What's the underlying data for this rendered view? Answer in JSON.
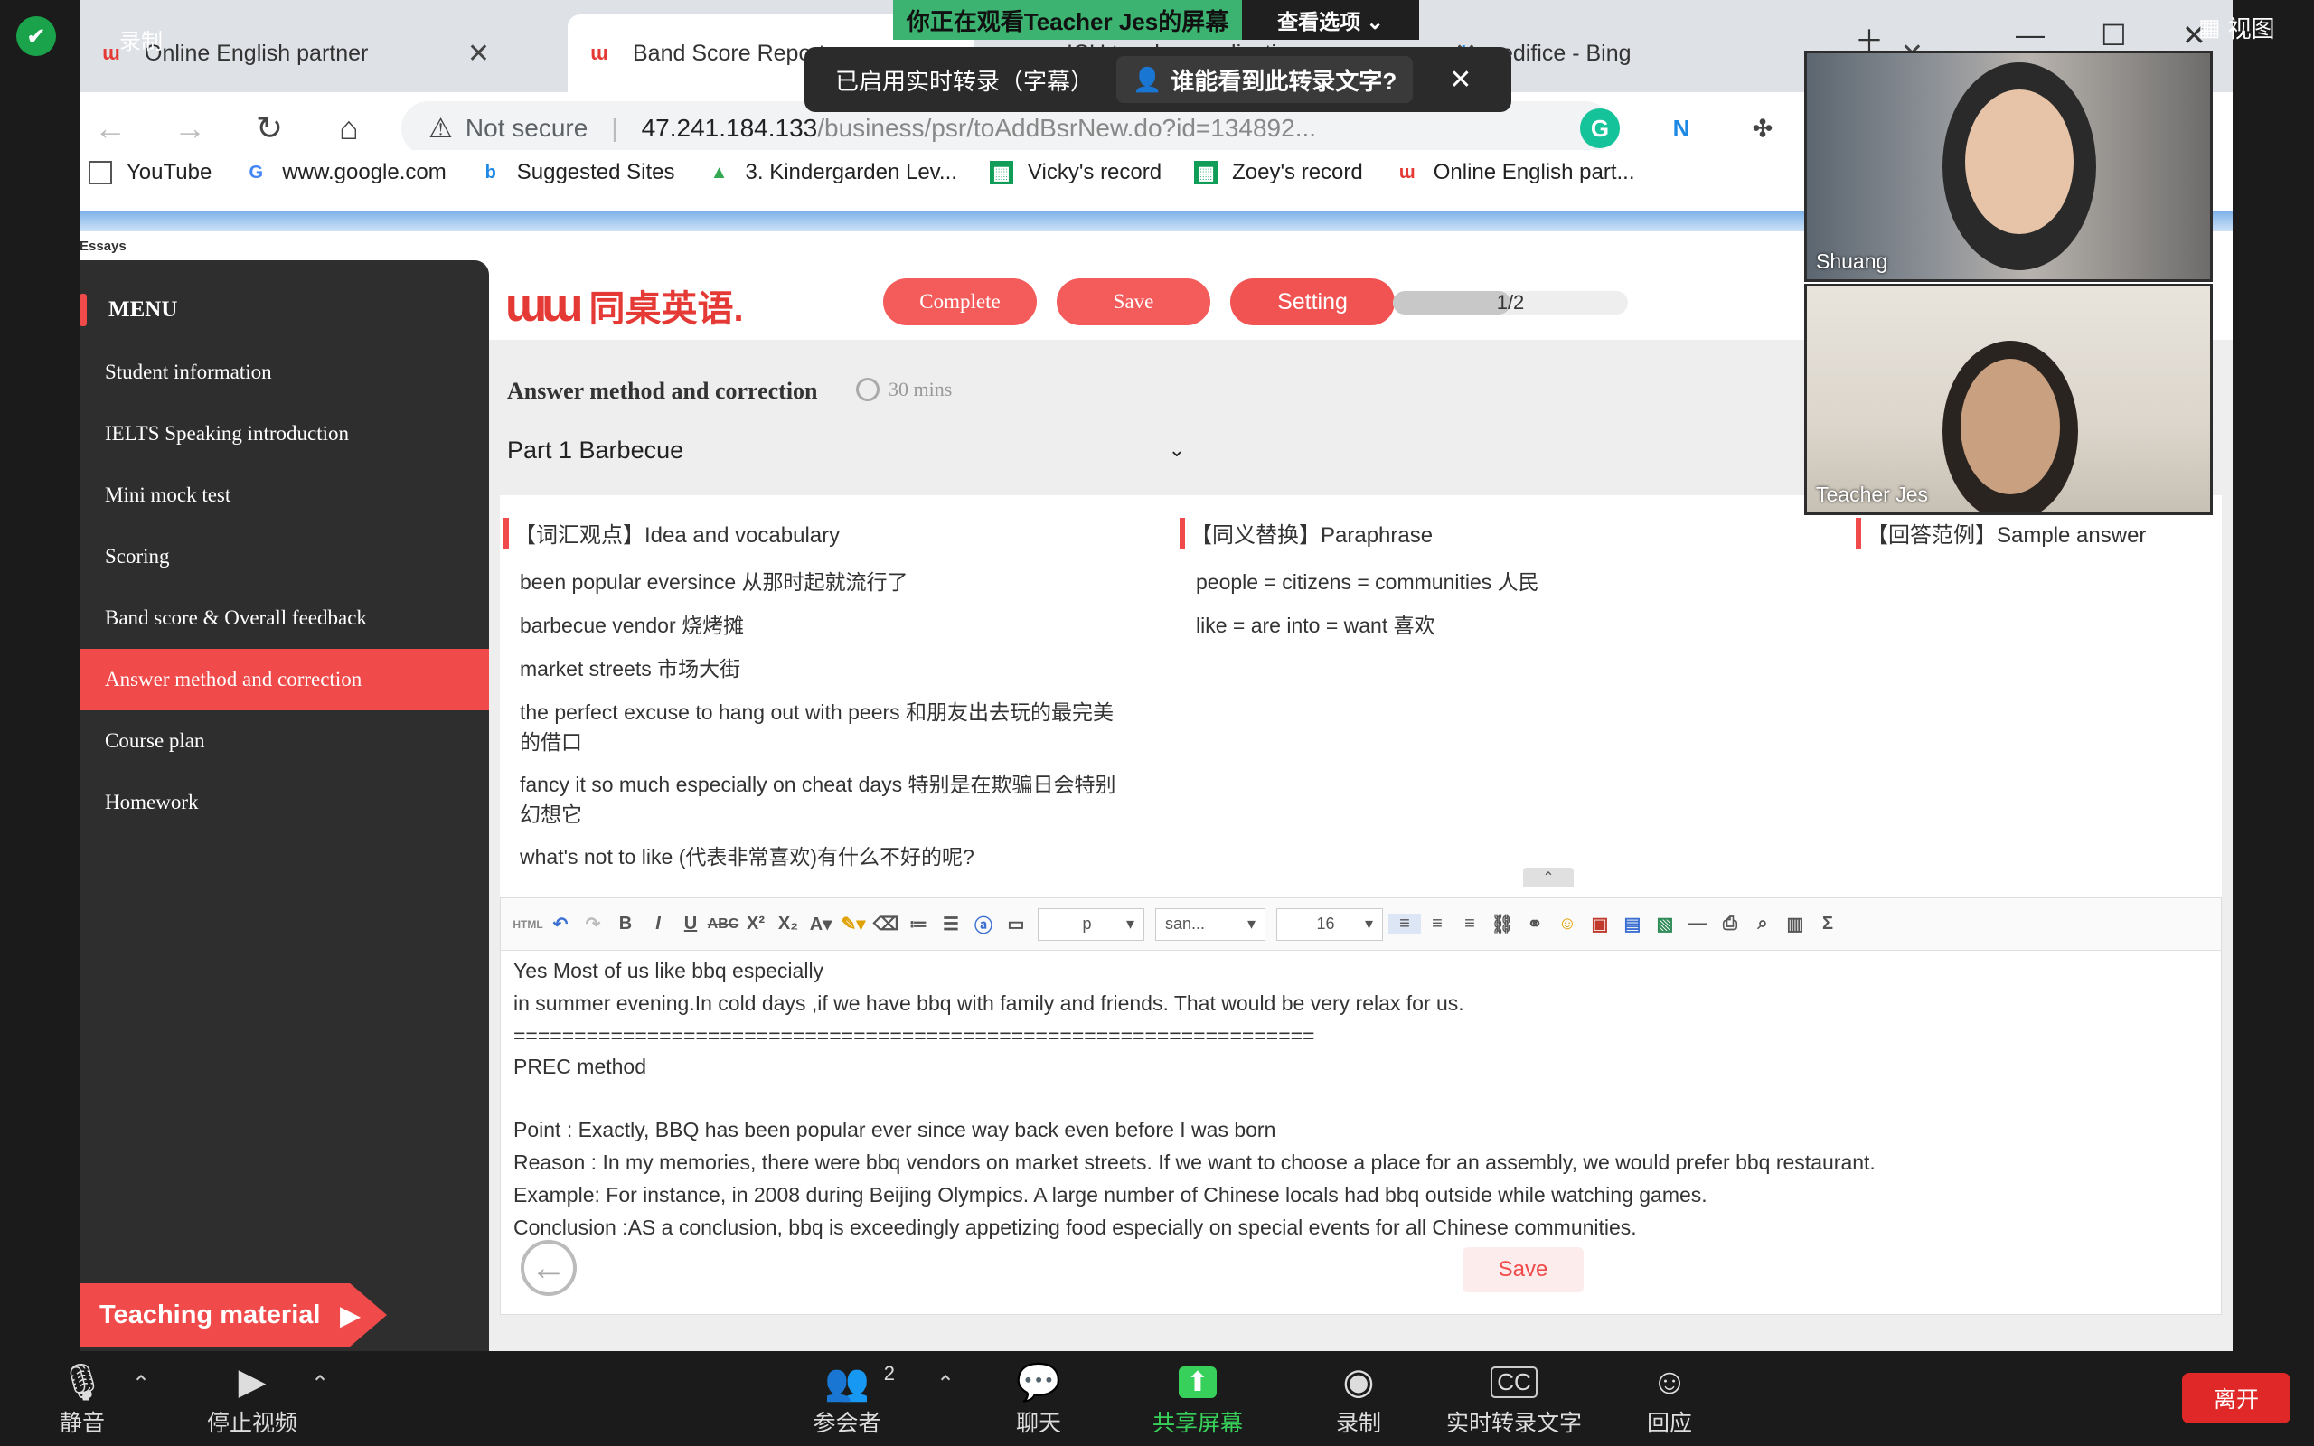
{
  "zoom": {
    "banner": "你正在观看Teacher Jes的屏幕",
    "view_options": "查看选项 ⌄",
    "recording_label": "录制",
    "view_label": "视图",
    "caption_text": "已启用实时转录（字幕）",
    "caption_who": "谁能看到此转录文字?",
    "caption_close": "✕",
    "participants": [
      {
        "name": "Shuang"
      },
      {
        "name": "Teacher Jes"
      }
    ],
    "bottom": {
      "mute": "静音",
      "stop_video": "停止视频",
      "participants": "参会者",
      "participants_count": "2",
      "chat": "聊天",
      "share": "共享屏幕",
      "record": "录制",
      "transcript": "实时转录文字",
      "react": "回应",
      "leave": "离开"
    }
  },
  "browser": {
    "tabs": [
      {
        "label": "Online English partner"
      },
      {
        "label": "Band Score Report"
      },
      {
        "label": "ICU teacher application"
      },
      {
        "label": "edifice - Bing"
      }
    ],
    "not_secure": "Not secure",
    "url": "47.241.184.133",
    "url_rest": "/business/psr/toAddBsrNew.do?id=134892...",
    "bookmarks": [
      "YouTube",
      "www.google.com",
      "Suggested Sites",
      "3. Kindergarden Lev...",
      "Vicky's record",
      "Zoey's record",
      "Online English part..."
    ],
    "essays_label": "Essays"
  },
  "app": {
    "menu_title": "MENU",
    "menu": [
      "Student information",
      "IELTS Speaking introduction",
      "Mini mock test",
      "Scoring",
      "Band score & Overall feedback",
      "Answer method and correction",
      "Course plan",
      "Homework"
    ],
    "active_menu": "Answer method and correction",
    "teaching_material": "Teaching material",
    "logo_text": "同桌英语.",
    "buttons": {
      "complete": "Complete",
      "save": "Save",
      "setting": "Setting"
    },
    "progress": {
      "label": "1/2",
      "value": 0.5
    },
    "section_title": "Answer method and correction",
    "timer": "30 mins",
    "part": "Part 1  Barbecue",
    "columns": {
      "vocab": "【词汇观点】Idea and vocabulary",
      "paraphrase": "【同义替换】Paraphrase",
      "sample": "【回答范例】Sample answer"
    },
    "vocab_items": [
      "been popular eversince 从那时起就流行了",
      "barbecue vendor 烧烤摊",
      "market streets 市场大街",
      "the perfect excuse to hang out with peers 和朋友出去玩的最完美的借口",
      "fancy it so much especially on cheat days 特别是在欺骗日会特别幻想它",
      "what's not to like (代表非常喜欢)有什么不好的呢?"
    ],
    "paraphrase_items": [
      "people = citizens = communities 人民",
      "like = are into = want 喜欢"
    ],
    "editor": {
      "format_select": "p",
      "font_select": "san...",
      "size_select": "16",
      "lines": [
        "Yes Most of us like bbq especially",
        " in summer  evening.In cold days ,if we have bbq  with  family and friends. That would be very relax for us.",
        "==================================================================",
        "PREC method",
        "",
        "Point : Exactly, BBQ has been popular ever since way back even before I was born",
        "Reason : In my memories, there were bbq vendors on market streets. If we want to choose a place for an assembly, we would prefer bbq restaurant.",
        "Example: For instance, in 2008  during Beijing Olympics.  A  large number of  Chinese locals had bbq outside while watching games.",
        "Conclusion :AS a  conclusion, bbq is exceedingly appetizing food especially on special events for all Chinese communities."
      ],
      "save_label": "Save"
    }
  }
}
